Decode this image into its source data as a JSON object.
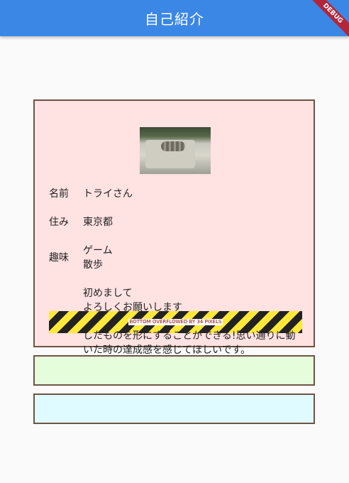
{
  "appbar": {
    "title": "自己紹介",
    "debug_banner": "DEBUG"
  },
  "profile": {
    "name_label": "名前",
    "name_value": "トライさん",
    "address_label": "住み",
    "address_value": "東京都",
    "hobby_label": "趣味",
    "hobby_1": "ゲーム",
    "hobby_2": "散歩",
    "intro_1": "初めまして",
    "intro_2": "よろしくお願いします",
    "intro_3": "したものを形にすることができる!思い通りに動",
    "intro_4": "いた時の達成感を感じてほしいです。"
  },
  "overflow_warning": "BOTTOM OVERFLOWED BY 34 PIXELS"
}
